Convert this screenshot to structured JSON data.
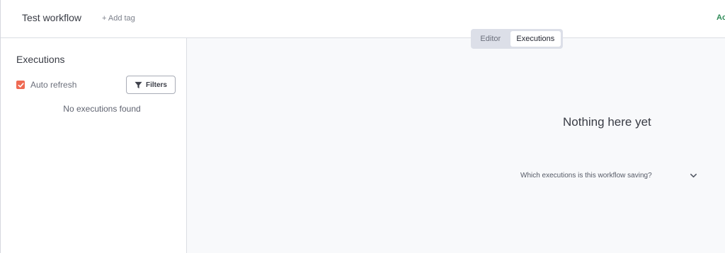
{
  "header": {
    "workflow_title": "Test workflow",
    "add_tag_label": "+ Add tag",
    "active_label": "Ac"
  },
  "view_toggle": {
    "options": [
      "Editor",
      "Executions"
    ],
    "selected": "Executions"
  },
  "sidebar": {
    "title": "Executions",
    "auto_refresh_label": "Auto refresh",
    "auto_refresh_checked": true,
    "filters_label": "Filters",
    "empty_text": "No executions found"
  },
  "main": {
    "empty_title": "Nothing here yet",
    "saving_question": "Which executions is this workflow saving?"
  },
  "icons": {
    "checkbox": "check-icon",
    "filters": "filter-funnel-icon",
    "expand": "chevron-down-icon"
  },
  "colors": {
    "accent": "#ef6a53",
    "active_green": "#2e8b57",
    "toggle_bg": "#dcdfe8",
    "main_bg": "#f8f9fb"
  }
}
